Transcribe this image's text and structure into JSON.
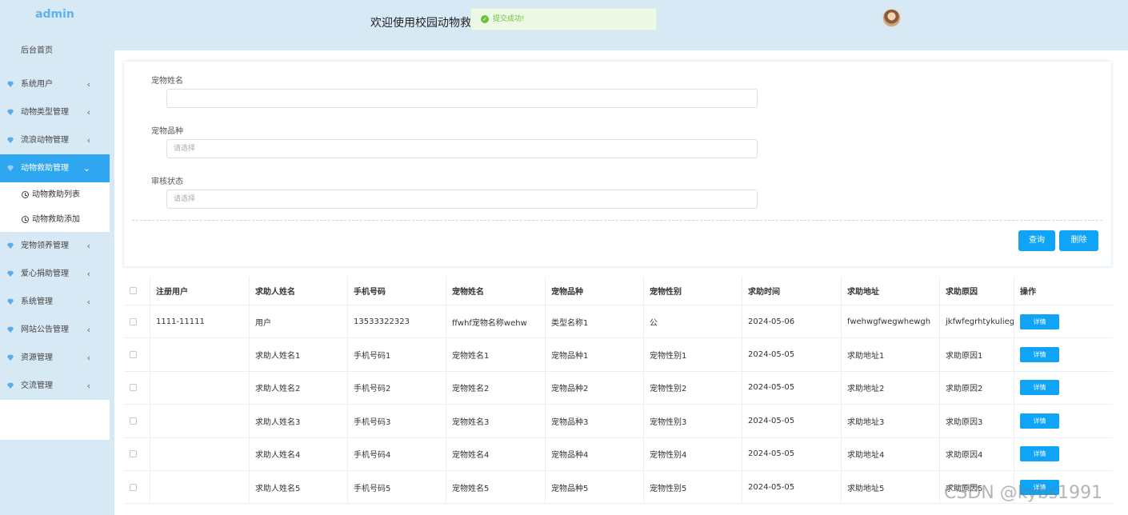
{
  "sidebar": {
    "logo": "admin",
    "home": "后台首页",
    "items": [
      {
        "label": "系统用户"
      },
      {
        "label": "动物类型管理"
      },
      {
        "label": "流浪动物管理"
      },
      {
        "label": "动物救助管理"
      },
      {
        "label": "宠物领养管理"
      },
      {
        "label": "爱心捐助管理"
      },
      {
        "label": "系统管理"
      },
      {
        "label": "网站公告管理"
      },
      {
        "label": "资源管理"
      },
      {
        "label": "交流管理"
      }
    ],
    "submenu": [
      "动物救助列表",
      "动物救助添加"
    ],
    "active_color": "#2fa7f0"
  },
  "header": {
    "title": "欢迎使用校园动物救",
    "toast": "提交成功!"
  },
  "search": {
    "name_label": "宠物姓名",
    "name_value": "",
    "breed_label": "宠物品种",
    "breed_placeholder": "请选择",
    "status_label": "审核状态",
    "status_placeholder": "请选择",
    "query_btn": "查询",
    "delete_btn": "删除"
  },
  "table": {
    "headers": [
      "注册用户",
      "求助人姓名",
      "手机号码",
      "宠物姓名",
      "宠物品种",
      "宠物性别",
      "求助时间",
      "求助地址",
      "求助原因",
      "操作"
    ],
    "detail_label": "详情",
    "rows": [
      [
        "1111-11111",
        "用户",
        "13533322323",
        "ffwhf宠物名称wehw",
        "类型名称1",
        "公",
        "2024-05-06",
        "fwehwgfwegwhewgh",
        "jkfwfegrhtykulieghfghrjt"
      ],
      [
        "",
        "求助人姓名1",
        "手机号码1",
        "宠物姓名1",
        "宠物品种1",
        "宠物性别1",
        "2024-05-05",
        "求助地址1",
        "求助原因1"
      ],
      [
        "",
        "求助人姓名2",
        "手机号码2",
        "宠物姓名2",
        "宠物品种2",
        "宠物性别2",
        "2024-05-05",
        "求助地址2",
        "求助原因2"
      ],
      [
        "",
        "求助人姓名3",
        "手机号码3",
        "宠物姓名3",
        "宠物品种3",
        "宠物性别3",
        "2024-05-05",
        "求助地址3",
        "求助原因3"
      ],
      [
        "",
        "求助人姓名4",
        "手机号码4",
        "宠物姓名4",
        "宠物品种4",
        "宠物性别4",
        "2024-05-05",
        "求助地址4",
        "求助原因4"
      ],
      [
        "",
        "求助人姓名5",
        "手机号码5",
        "宠物姓名5",
        "宠物品种5",
        "宠物性别5",
        "2024-05-05",
        "求助地址5",
        "求助原因5"
      ]
    ]
  },
  "watermark": "CSDN @kybs1991",
  "accent_color": "#0fa4f5"
}
